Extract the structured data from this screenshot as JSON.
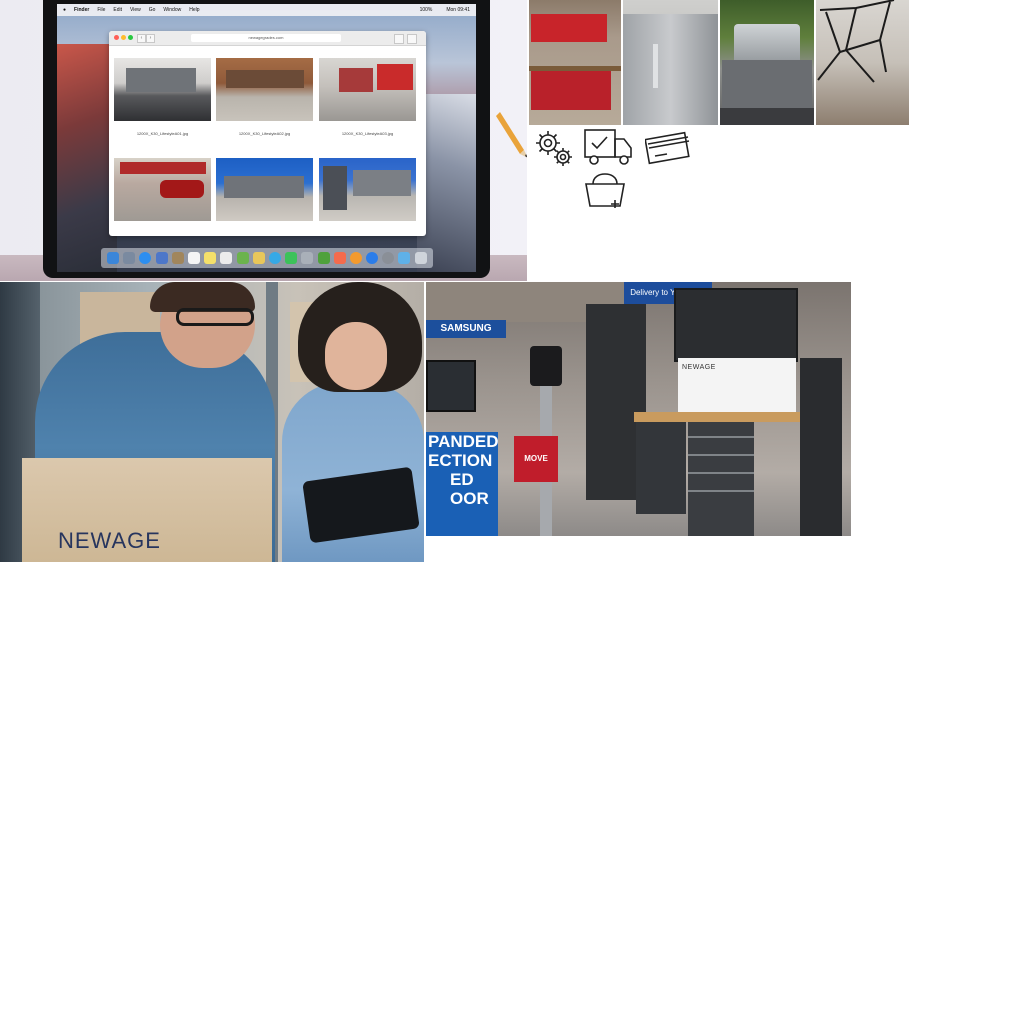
{
  "laptop": {
    "menubar": {
      "app": "Finder",
      "items": [
        "File",
        "Edit",
        "View",
        "Go",
        "Window",
        "Help"
      ],
      "battery": "100%",
      "clock": "Mon 09:41"
    },
    "browser": {
      "url": "newagegrades.com",
      "thumbnails": [
        {
          "caption": "1200X_K30_LifestyleA01.jpg"
        },
        {
          "caption": "1200X_K30_LifestyleA02.jpg"
        },
        {
          "caption": "1200X_K30_LifestyleA03.jpg"
        },
        {
          "caption": ""
        },
        {
          "caption": ""
        },
        {
          "caption": ""
        }
      ]
    }
  },
  "icons": [
    {
      "name": "gear-icon"
    },
    {
      "name": "delivery-truck-icon"
    },
    {
      "name": "credit-card-icon"
    },
    {
      "name": "basket-add-icon"
    }
  ],
  "team_photo": {
    "box_logo": "NEWAGE"
  },
  "store_photo": {
    "sign_brand": "SAMSUNG",
    "banner_line1": "PANDED",
    "banner_line2": "ECTION",
    "banner_line3": "ED",
    "banner_line4": "OOR",
    "top_banner": "Delivery to Your Door",
    "red_tag": "MOVE",
    "display_logo": "NEWAGE"
  }
}
